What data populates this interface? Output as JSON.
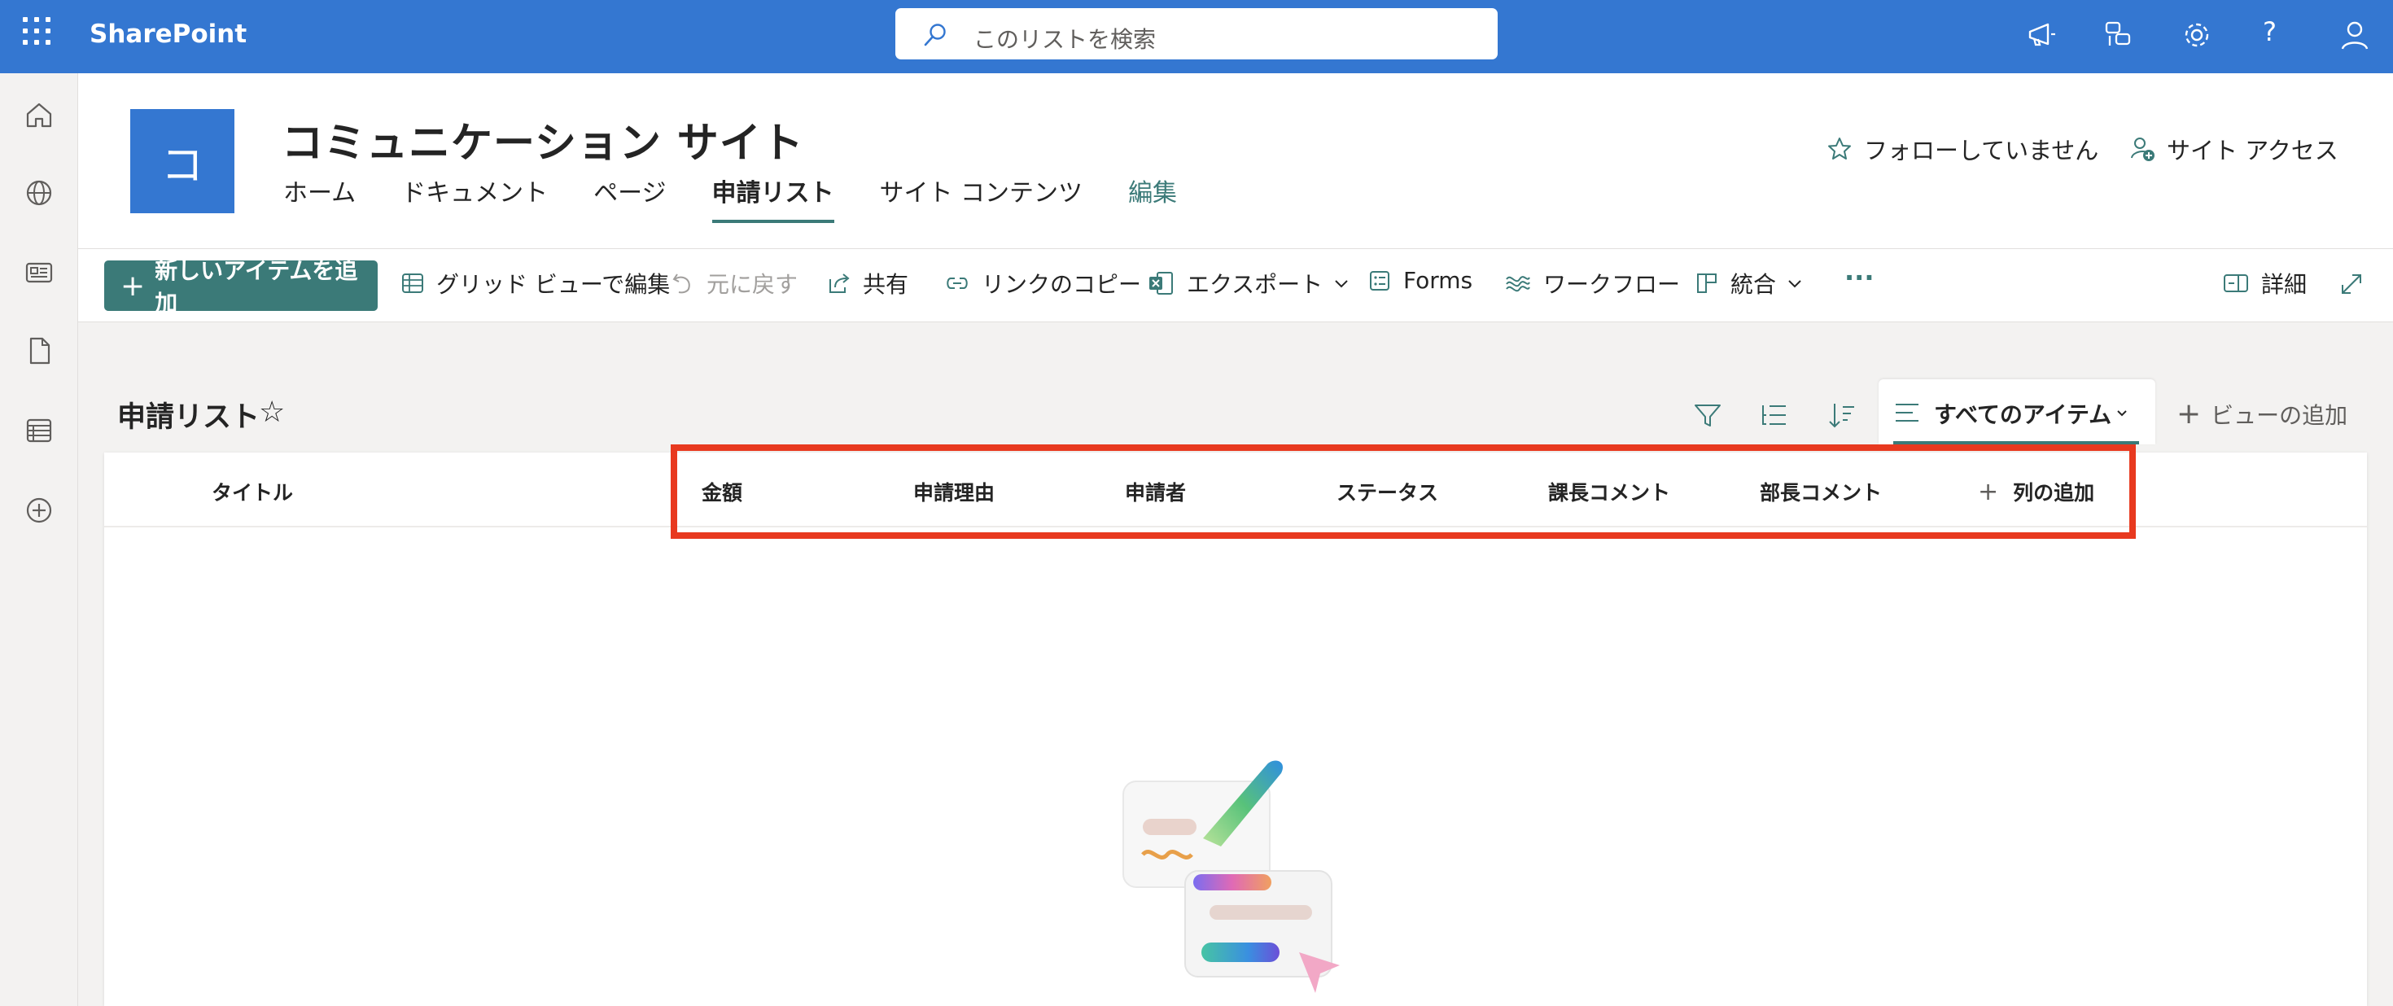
{
  "suitebar": {
    "app_name": "SharePoint",
    "search_placeholder": "このリストを検索"
  },
  "site": {
    "logo_letter": "コ",
    "title": "コミュニケーション サイト",
    "nav": [
      {
        "label": "ホーム",
        "state": "normal"
      },
      {
        "label": "ドキュメント",
        "state": "normal"
      },
      {
        "label": "ページ",
        "state": "normal"
      },
      {
        "label": "申請リスト",
        "state": "active"
      },
      {
        "label": "サイト コンテンツ",
        "state": "normal"
      },
      {
        "label": "編集",
        "state": "edit"
      }
    ],
    "follow_label": "フォローしていません",
    "access_label": "サイト アクセス"
  },
  "commandbar": {
    "new_item": "新しいアイテムを追加",
    "grid_edit": "グリッド ビューで編集",
    "undo": "元に戻す",
    "share": "共有",
    "copy_link": "リンクのコピー",
    "export": "エクスポート",
    "forms": "Forms",
    "workflow": "ワークフロー",
    "integrate": "統合",
    "more": "···",
    "details": "詳細"
  },
  "list": {
    "title": "申請リスト",
    "view_name": "すべてのアイテム",
    "add_view": "ビューの追加",
    "columns": [
      "タイトル",
      "金額",
      "申請理由",
      "申請者",
      "ステータス",
      "課長コメント",
      "部長コメント"
    ],
    "add_column": "列の追加"
  },
  "colors": {
    "suitebar": "#3477d1",
    "accent": "#3b7a78",
    "highlight": "#e8391f"
  }
}
